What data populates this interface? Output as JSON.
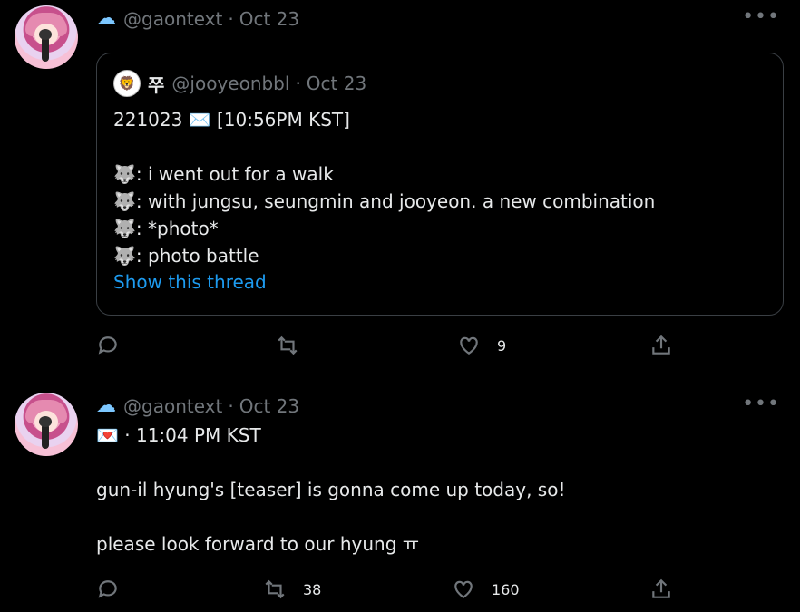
{
  "tweets": [
    {
      "header_icon": "cloud-emoji",
      "handle": "@gaontext",
      "date": "Oct 23",
      "more": "•••",
      "quote": {
        "avatar_glyph": "🦁",
        "name": "쭈",
        "handle": "@jooyeonbbl",
        "date": "Oct 23",
        "lines": [
          "221023 ✉️ [10:56PM KST]",
          "",
          "🐺: i went out for a walk",
          "🐺: with jungsu, seungmin and jooyeon. a new combination",
          "🐺: *photo*",
          "🐺: photo battle"
        ],
        "show_thread": "Show this thread"
      },
      "actions": {
        "reply_count": "",
        "retweet_count": "",
        "like_count": "9"
      }
    },
    {
      "header_icon": "cloud-emoji",
      "handle": "@gaontext",
      "date": "Oct 23",
      "more": "•••",
      "lines": [
        "💌 · 11:04 PM KST",
        "",
        "gun-il hyung's [teaser] is gonna come up today, so!",
        "",
        "please look forward to our hyung ㅠ"
      ],
      "actions": {
        "reply_count": "",
        "retweet_count": "38",
        "like_count": "160"
      }
    }
  ],
  "colors": {
    "background": "#000000",
    "text": "#e7e9ea",
    "muted": "#71767b",
    "link": "#1d9bf0",
    "border": "#2f3336"
  }
}
